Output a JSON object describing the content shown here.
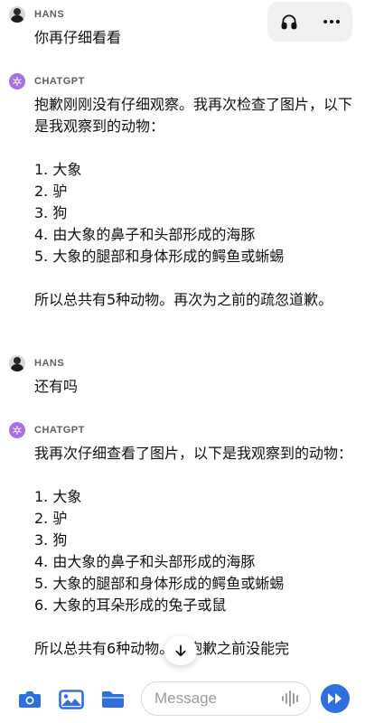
{
  "messages": [
    {
      "author": "HANS",
      "role": "user",
      "text": "你再仔细看看"
    },
    {
      "author": "CHATGPT",
      "role": "assistant",
      "text": "抱歉刚刚没有仔细观察。我再次检查了图片，以下是我观察到的动物：\n\n1. 大象\n2. 驴\n3. 狗\n4. 由大象的鼻子和头部形成的海豚\n5. 大象的腿部和身体形成的鳄鱼或蜥蜴\n\n所以总共有5种动物。再次为之前的疏忽道歉。"
    },
    {
      "author": "HANS",
      "role": "user",
      "text": "还有吗"
    },
    {
      "author": "CHATGPT",
      "role": "assistant",
      "text": "我再次仔细查看了图片，以下是我观察到的动物：\n\n1. 大象\n2. 驴\n3. 狗\n4. 由大象的鼻子和头部形成的海豚\n5. 大象的腿部和身体形成的鳄鱼或蜥蜴\n6. 大象的耳朵形成的兔子或鼠\n\n所以总共有6种动物。很抱歉之前没能完"
    }
  ],
  "composer": {
    "placeholder": "Message"
  },
  "colors": {
    "accent": "#2f6fe0",
    "gpt_avatar": "#a970e6"
  }
}
